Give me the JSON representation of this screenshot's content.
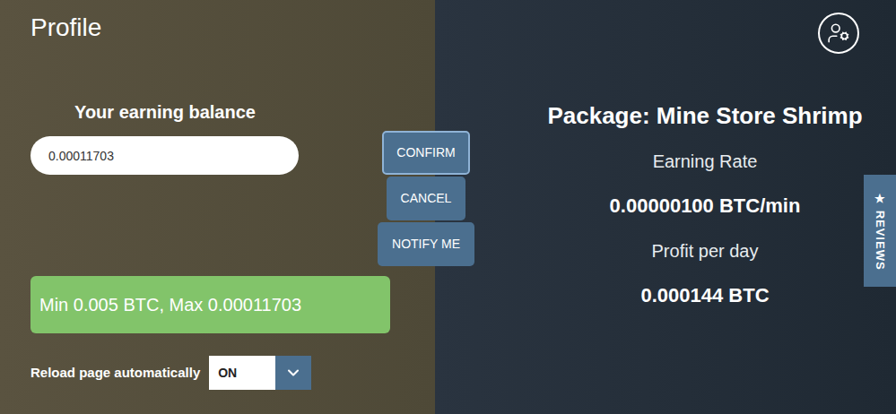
{
  "header": {
    "title": "Profile"
  },
  "balance": {
    "label": "Your earning balance",
    "value": "0.00011703"
  },
  "buttons": [
    {
      "label": "CONFIRM",
      "focused": true
    },
    {
      "label": "CANCEL",
      "focused": false
    },
    {
      "label": "NOTIFY ME",
      "focused": false
    }
  ],
  "limits": "Min 0.005 BTC, Max 0.00011703",
  "reload": {
    "label": "Reload page automatically",
    "value": "ON"
  },
  "package": {
    "title": "Package: Mine Store Shrimp",
    "stats": [
      {
        "label": "Earning Rate",
        "value": "0.00000100 BTC/min"
      },
      {
        "label": "Profit per day",
        "value": "0.000144 BTC"
      }
    ]
  },
  "reviews_tab": {
    "icon": "★",
    "label": "REVIEWS"
  }
}
